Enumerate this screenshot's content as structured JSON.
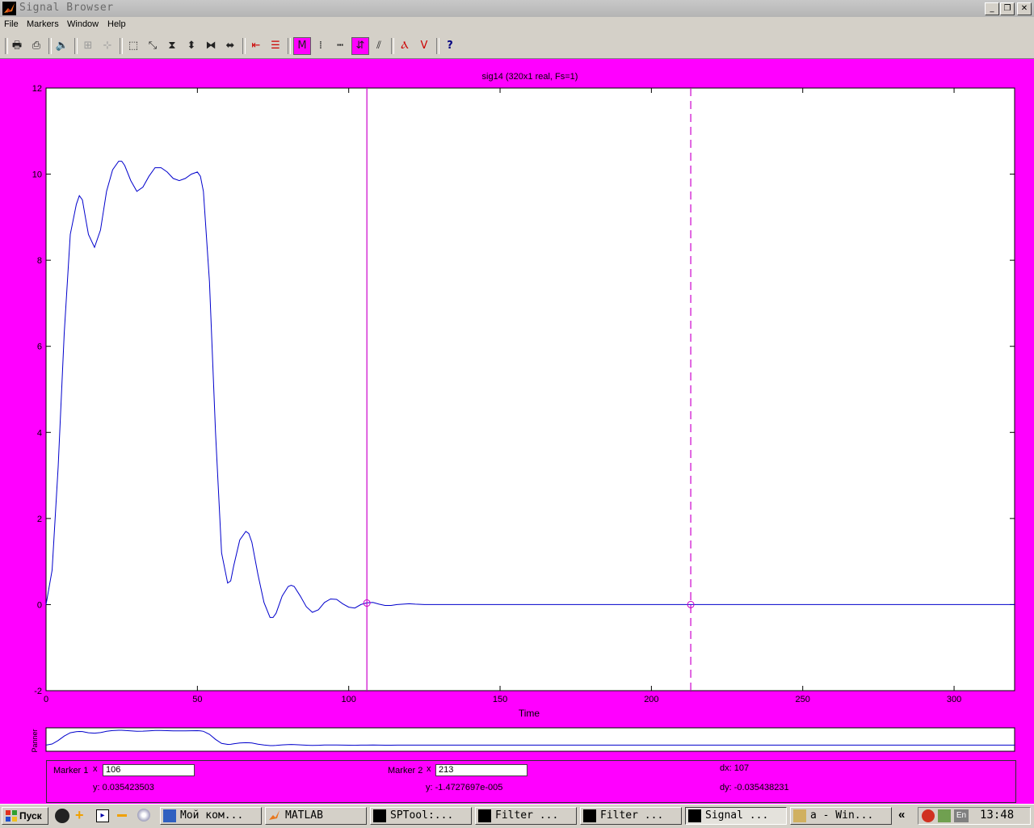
{
  "window": {
    "title": "Signal Browser",
    "minimize": "_",
    "restore": "❐",
    "close": "✕"
  },
  "menu": [
    "File",
    "Markers",
    "Window",
    "Help"
  ],
  "toolbar": {
    "icons": [
      "print-icon",
      "print-preview-icon",
      "speaker-icon",
      "array-signals-icon",
      "select-signal-icon",
      "zoom-box-icon",
      "zoom-full-icon",
      "zoom-y-icon",
      "zoom-y-out-icon",
      "zoom-x-in-icon",
      "zoom-x-out-icon",
      "marker-icon",
      "line-properties-icon",
      "markers-toggle-icon",
      "vertical-markers-icon",
      "horizontal-markers-icon",
      "track-markers-icon",
      "slope-markers-icon",
      "peaks-icon",
      "valleys-icon",
      "whats-this-icon"
    ]
  },
  "chart_data": {
    "type": "line",
    "title": "sig14 (320x1 real, Fs=1)",
    "xlabel": "Time",
    "ylabel": "",
    "xlim": [
      0,
      320
    ],
    "ylim": [
      -2,
      12
    ],
    "xticks": [
      0,
      50,
      100,
      150,
      200,
      250,
      300
    ],
    "yticks": [
      -2,
      0,
      2,
      4,
      6,
      8,
      10,
      12
    ],
    "series": [
      {
        "color": "#0000cc",
        "x": [
          0,
          2,
          4,
          6,
          8,
          10,
          11,
          12,
          13,
          14,
          16,
          18,
          20,
          22,
          24,
          25,
          26,
          28,
          30,
          32,
          34,
          36,
          38,
          40,
          42,
          44,
          46,
          48,
          50,
          51,
          52,
          54,
          56,
          58,
          60,
          61,
          62,
          64,
          66,
          67,
          68,
          70,
          72,
          74,
          75,
          76,
          78,
          80,
          81,
          82,
          84,
          86,
          88,
          90,
          92,
          94,
          96,
          98,
          100,
          102,
          104,
          106,
          108,
          110,
          112,
          114,
          116,
          118,
          120,
          122,
          125,
          130,
          140,
          150,
          200,
          250,
          320
        ],
        "y": [
          0,
          0.8,
          3.2,
          6.3,
          8.6,
          9.3,
          9.5,
          9.4,
          9.0,
          8.6,
          8.3,
          8.7,
          9.6,
          10.1,
          10.3,
          10.3,
          10.2,
          9.85,
          9.6,
          9.7,
          9.95,
          10.15,
          10.15,
          10.05,
          9.9,
          9.85,
          9.9,
          10.0,
          10.05,
          9.95,
          9.6,
          7.5,
          4.0,
          1.2,
          0.5,
          0.55,
          0.9,
          1.5,
          1.7,
          1.65,
          1.45,
          0.7,
          0.05,
          -0.3,
          -0.3,
          -0.2,
          0.2,
          0.42,
          0.45,
          0.42,
          0.2,
          -0.05,
          -0.18,
          -0.12,
          0.05,
          0.13,
          0.12,
          0.02,
          -0.06,
          -0.08,
          0.0,
          0.04,
          0.05,
          0.01,
          -0.02,
          -0.02,
          0.0,
          0.01,
          0.02,
          0.01,
          0.0,
          0.0,
          0.0,
          0.0,
          0.0,
          0.0,
          0.0
        ]
      }
    ],
    "marker_lines": [
      {
        "x": 106,
        "y": 0.035423503,
        "style": "solid"
      },
      {
        "x": 213,
        "y": -1.4727697e-05,
        "style": "dashed"
      }
    ],
    "marker_color": "#cc00cc",
    "grid": false
  },
  "panner": {
    "label": "Panner"
  },
  "markers": {
    "m1_label": "Marker 1",
    "x_sym1": "x",
    "m1_x": "106",
    "m1_y": "y: 0.035423503",
    "m2_label": "Marker 2",
    "x_sym2": "x",
    "m2_x": "213",
    "m2_y": "y: -1.4727697e-005",
    "dx": "dx: 107",
    "dy": "dy: -0.035438231"
  },
  "taskbar": {
    "start": "Пуск",
    "tasks": [
      "Мой ком...",
      "MATLAB",
      "SPTool:...",
      "Filter ...",
      "Filter ...",
      "Signal ...",
      "a - Win..."
    ],
    "tray_arrow": "«",
    "lang": "En",
    "clock": "13:48"
  }
}
